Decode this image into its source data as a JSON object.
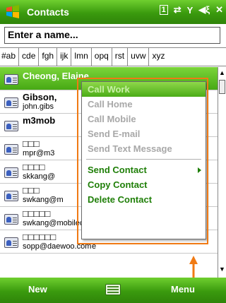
{
  "titlebar": {
    "title": "Contacts",
    "status_icons": [
      "1",
      "⇄",
      "Y",
      "◀ξ",
      "✕"
    ]
  },
  "search": {
    "value": "Enter a name..."
  },
  "index_tabs": [
    "#ab",
    "cde",
    "fgh",
    "ijk",
    "lmn",
    "opq",
    "rst",
    "uvw",
    "xyz"
  ],
  "contacts": [
    {
      "name": "Cheong, Elaine",
      "sub": "",
      "suffix": ""
    },
    {
      "name": "Gibson,",
      "sub": "john.gibs",
      "suffix": ""
    },
    {
      "name": "m3mob",
      "sub": "",
      "suffix": ""
    },
    {
      "name": "□□□",
      "sub": "mpr@m3",
      "suffix": ""
    },
    {
      "name": "□□□□",
      "sub": "skkang@",
      "suffix": ""
    },
    {
      "name": "□□□",
      "sub": "swkang@m",
      "suffix": "e"
    },
    {
      "name": "□□□□□",
      "sub": "swkang@mobilecompia.co.kr",
      "suffix": "e"
    },
    {
      "name": "□□□□□□",
      "sub": "sopp@daewoo.com",
      "suffix": "e"
    }
  ],
  "context_menu": {
    "items_disabled": [
      "Call Work",
      "Call Home",
      "Call Mobile",
      "Send E-mail",
      "Send Text Message"
    ],
    "items_enabled": [
      "Send Contact",
      "Copy Contact",
      "Delete Contact"
    ]
  },
  "bottombar": {
    "left_softkey": "New",
    "right_softkey": "Menu"
  },
  "colors": {
    "accent_green": "#47a914",
    "annotation_orange": "#f07a14",
    "menu_enabled_text": "#1f7f08"
  }
}
